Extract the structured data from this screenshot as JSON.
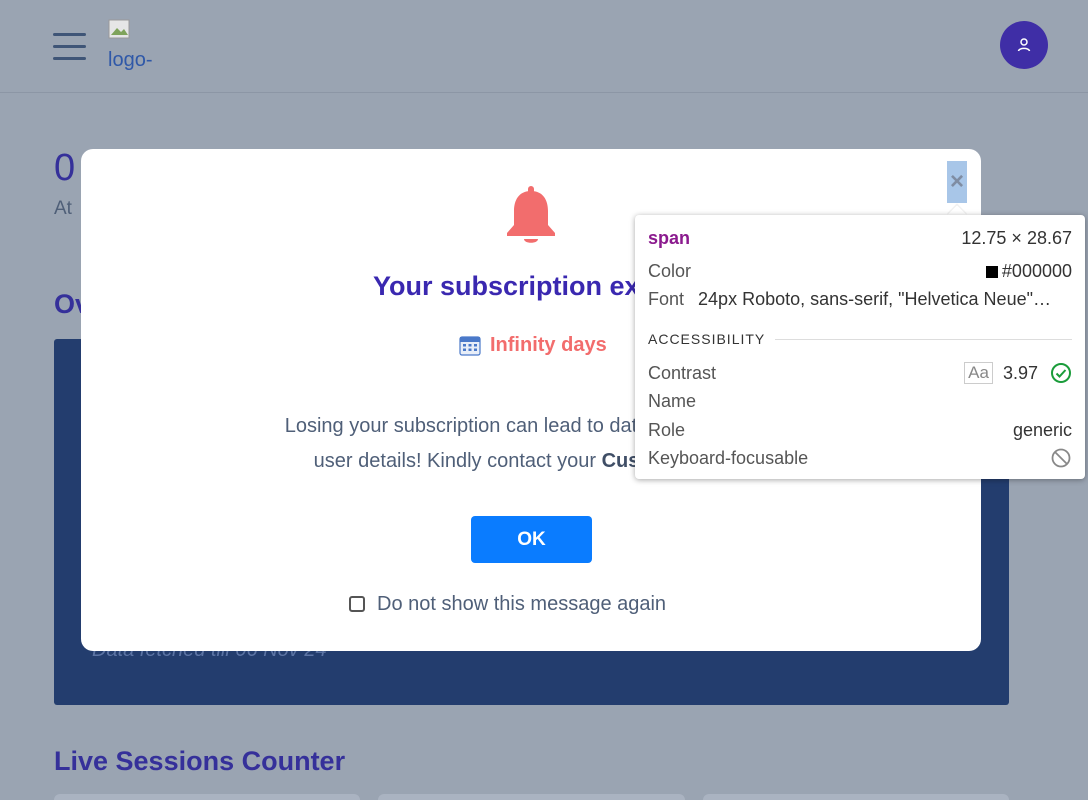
{
  "header": {
    "logo_alt": "logo-",
    "menu_icon": "hamburger-menu-icon",
    "avatar_icon": "user-icon"
  },
  "background": {
    "big_value": "0",
    "small_text": "At",
    "overview_partial": "Ov",
    "data_fetched": "Data fetched till 06 Nov 24",
    "live_sessions_title": "Live Sessions Counter"
  },
  "modal": {
    "bell_icon": "bell-icon",
    "title": "Your subscription expire",
    "days_icon": "calendar-icon",
    "days_text": "Infinity days",
    "message_line1": "Losing your subscription can lead to data loss and disru",
    "message_line2_prefix": "user details! Kindly contact your ",
    "message_line2_bold": "Customer Succ",
    "ok_label": "OK",
    "dont_show_label": "Do not show this message again",
    "dont_show_checked": false,
    "close_symbol": "×"
  },
  "devtools_tooltip": {
    "element": "span",
    "size": "12.75 × 28.67",
    "color_label": "Color",
    "color_value": "#000000",
    "font_label": "Font",
    "font_value": "24px Roboto, sans-serif, \"Helvetica Neue\"…",
    "section_title": "ACCESSIBILITY",
    "contrast_label": "Contrast",
    "contrast_value": "3.97",
    "aa_label": "Aa",
    "name_label": "Name",
    "role_label": "Role",
    "role_value": "generic",
    "keyboard_label": "Keyboard-focusable"
  },
  "colors": {
    "brand_purple": "#3a28b0",
    "accent_blue": "#0a7cff",
    "alert_red": "#f26d6d",
    "page_bg": "#9aa4b2"
  }
}
